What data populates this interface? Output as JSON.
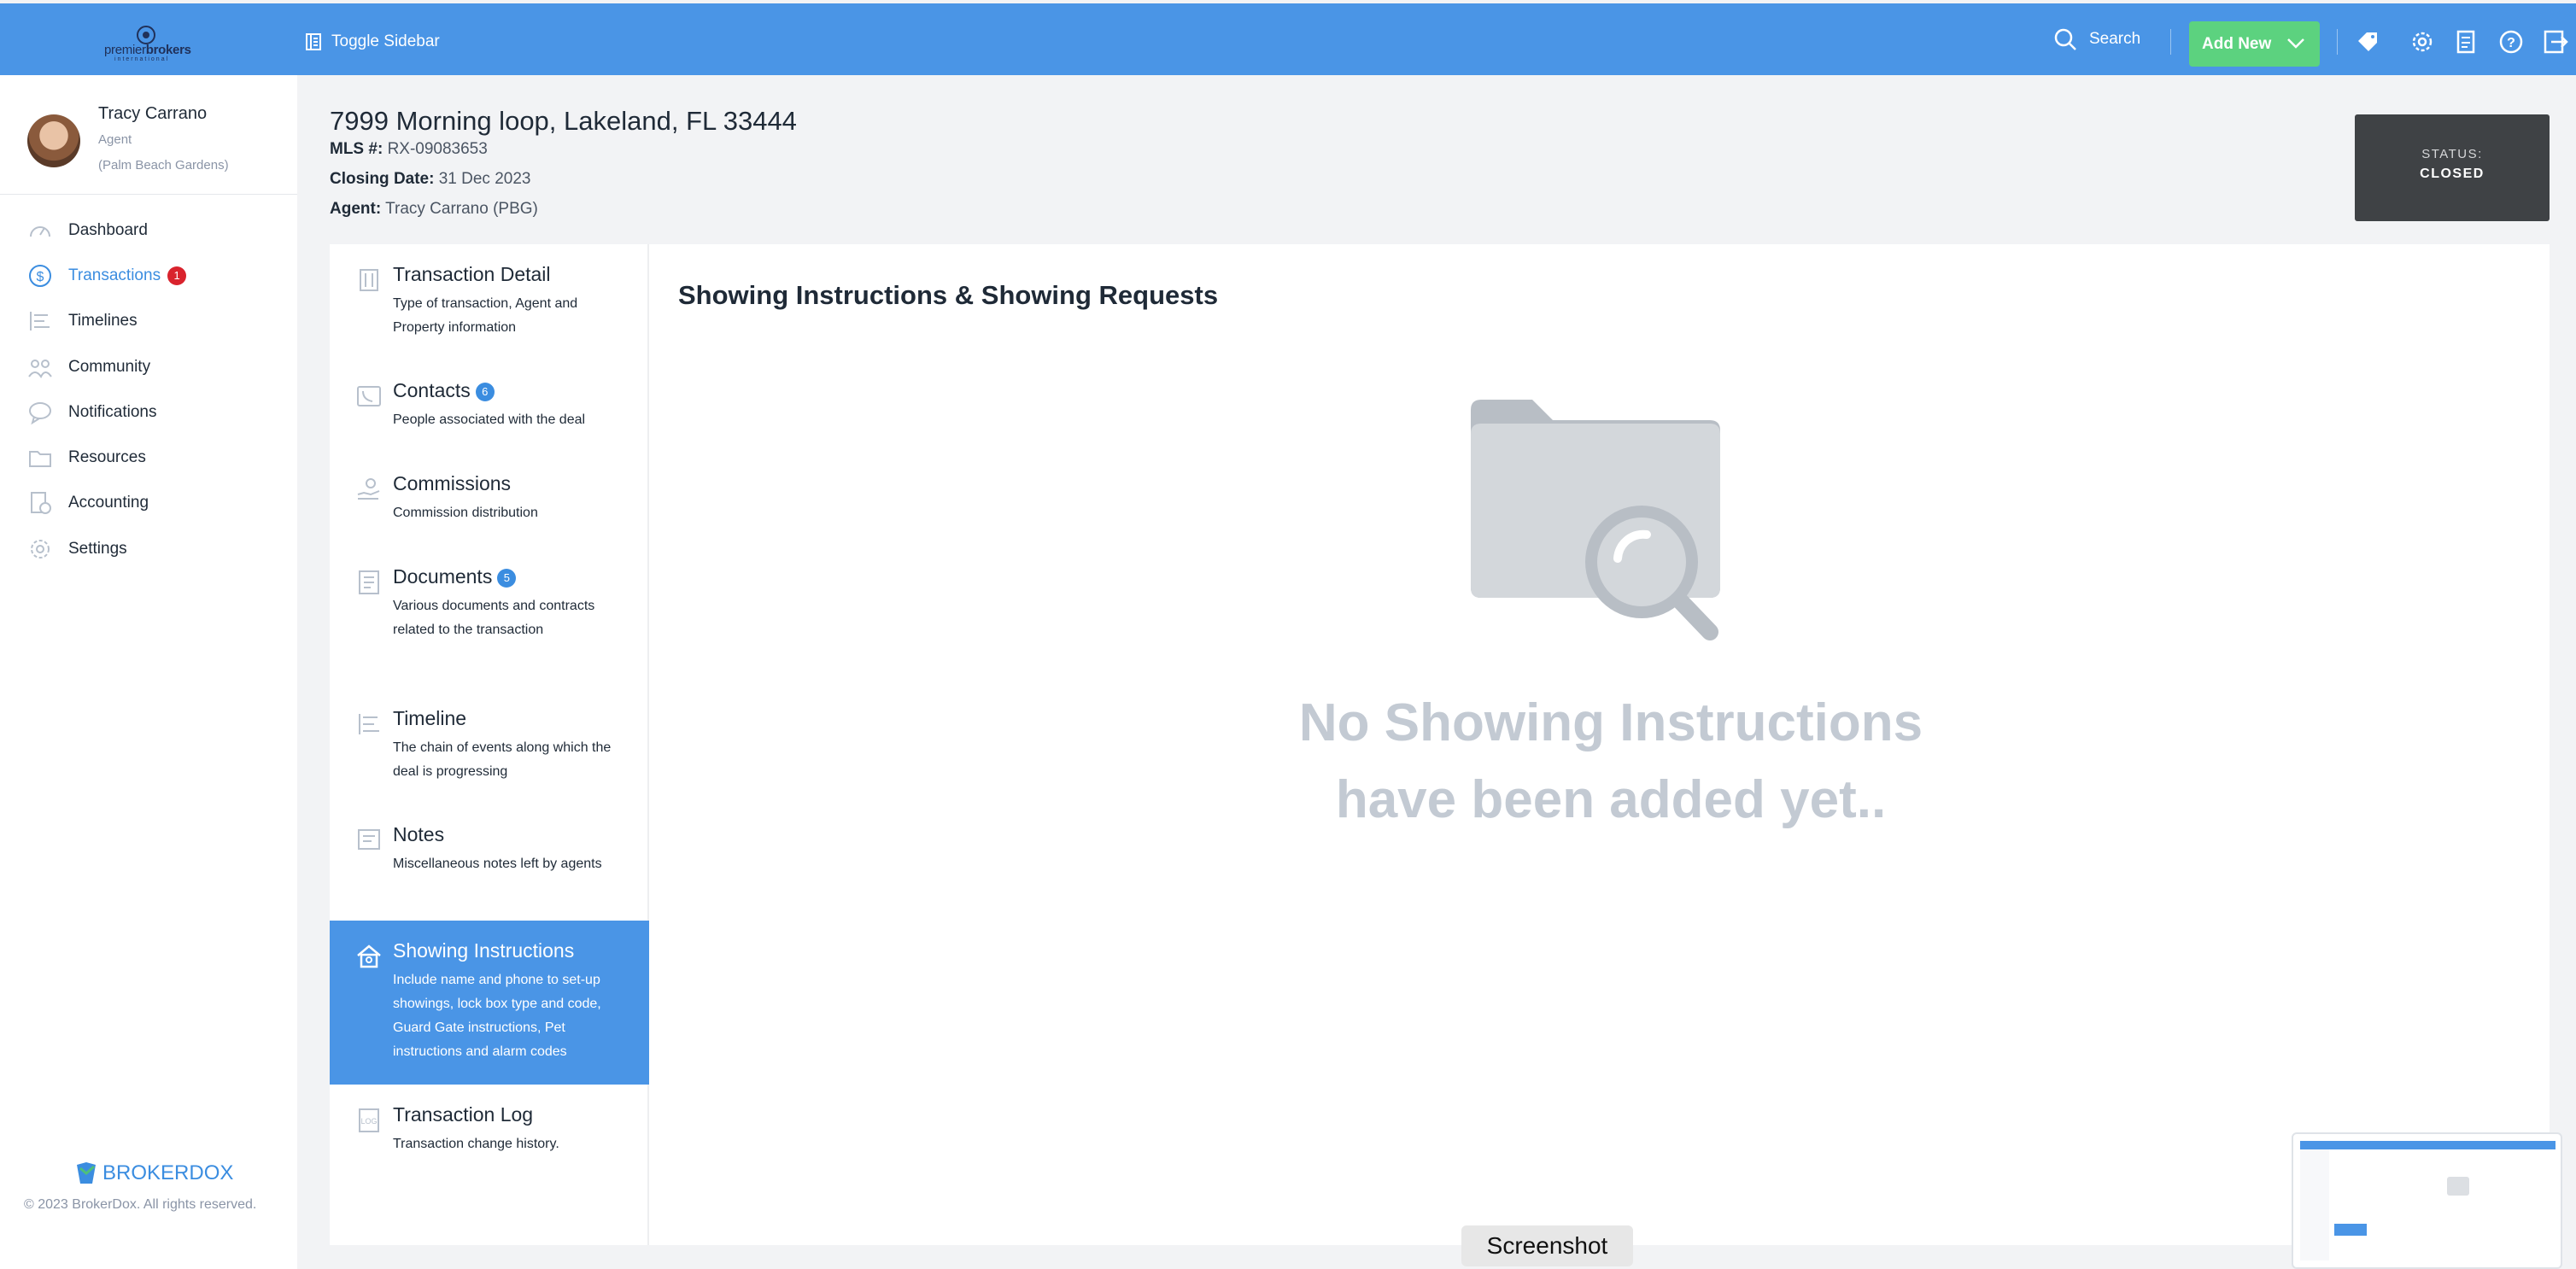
{
  "topbar": {
    "logo": {
      "word_light": "premier",
      "word_bold": "brokers",
      "tagline": "international"
    },
    "toggle_label": "Toggle Sidebar",
    "search_label": "Search",
    "add_new_label": "Add New",
    "icons": [
      "tag-icon",
      "gear-icon",
      "calculator-doc-icon",
      "help-icon",
      "logout-icon"
    ]
  },
  "user": {
    "name": "Tracy Carrano",
    "role": "Agent",
    "office": "(Palm Beach Gardens)"
  },
  "nav": [
    {
      "label": "Dashboard",
      "icon": "speedometer-icon"
    },
    {
      "label": "Transactions",
      "icon": "dollar-icon",
      "badge": "1",
      "active": true
    },
    {
      "label": "Timelines",
      "icon": "timeline-icon"
    },
    {
      "label": "Community",
      "icon": "people-icon"
    },
    {
      "label": "Notifications",
      "icon": "chat-bubble-icon"
    },
    {
      "label": "Resources",
      "icon": "folder-icon"
    },
    {
      "label": "Accounting",
      "icon": "ledger-icon"
    },
    {
      "label": "Settings",
      "icon": "gear-icon"
    }
  ],
  "footer": {
    "brand": "BROKERDOX",
    "copyright": "© 2023 BrokerDox. All rights reserved."
  },
  "header": {
    "address": "7999 Morning loop, Lakeland, FL 33444",
    "mls_label": "MLS #:",
    "mls_value": "RX-09083653",
    "closing_label": "Closing Date:",
    "closing_value": "31 Dec 2023",
    "agent_label": "Agent:",
    "agent_value": "Tracy Carrano (PBG)",
    "status_label": "STATUS:",
    "status_value": "CLOSED"
  },
  "tabs": [
    {
      "title": "Transaction Detail",
      "desc": "Type of transaction, Agent and Property information",
      "icon": "building-icon"
    },
    {
      "title": "Contacts",
      "badge": "6",
      "desc": "People associated with the deal",
      "icon": "phone-icon"
    },
    {
      "title": "Commissions",
      "desc": "Commission distribution",
      "icon": "hand-coin-icon"
    },
    {
      "title": "Documents",
      "badge": "5",
      "desc": "Various documents and contracts related to the transaction",
      "icon": "document-icon"
    },
    {
      "title": "Timeline",
      "desc": "The chain of events along which the deal is progressing",
      "icon": "timeline-icon"
    },
    {
      "title": "Notes",
      "desc": "Miscellaneous notes left by agents",
      "icon": "note-icon"
    },
    {
      "title": "Showing Instructions",
      "desc": "Include name and phone to set-up showings, lock box type and code, Guard Gate instructions, Pet instructions and alarm codes",
      "icon": "house-icon",
      "active": true
    },
    {
      "title": "Transaction Log",
      "desc": "Transaction change history.",
      "icon": "log-icon"
    }
  ],
  "panel": {
    "title": "Showing Instructions & Showing Requests",
    "empty_line1": "No Showing Instructions",
    "empty_line2": "have been added yet.."
  },
  "overlay": {
    "screenshot_label": "Screenshot"
  },
  "colors": {
    "topbar": "#4a95e6",
    "add_new": "#5cd27f",
    "status_bg": "#3f4245",
    "active_tab": "#4a95e6",
    "badge_red": "#d9232d"
  }
}
